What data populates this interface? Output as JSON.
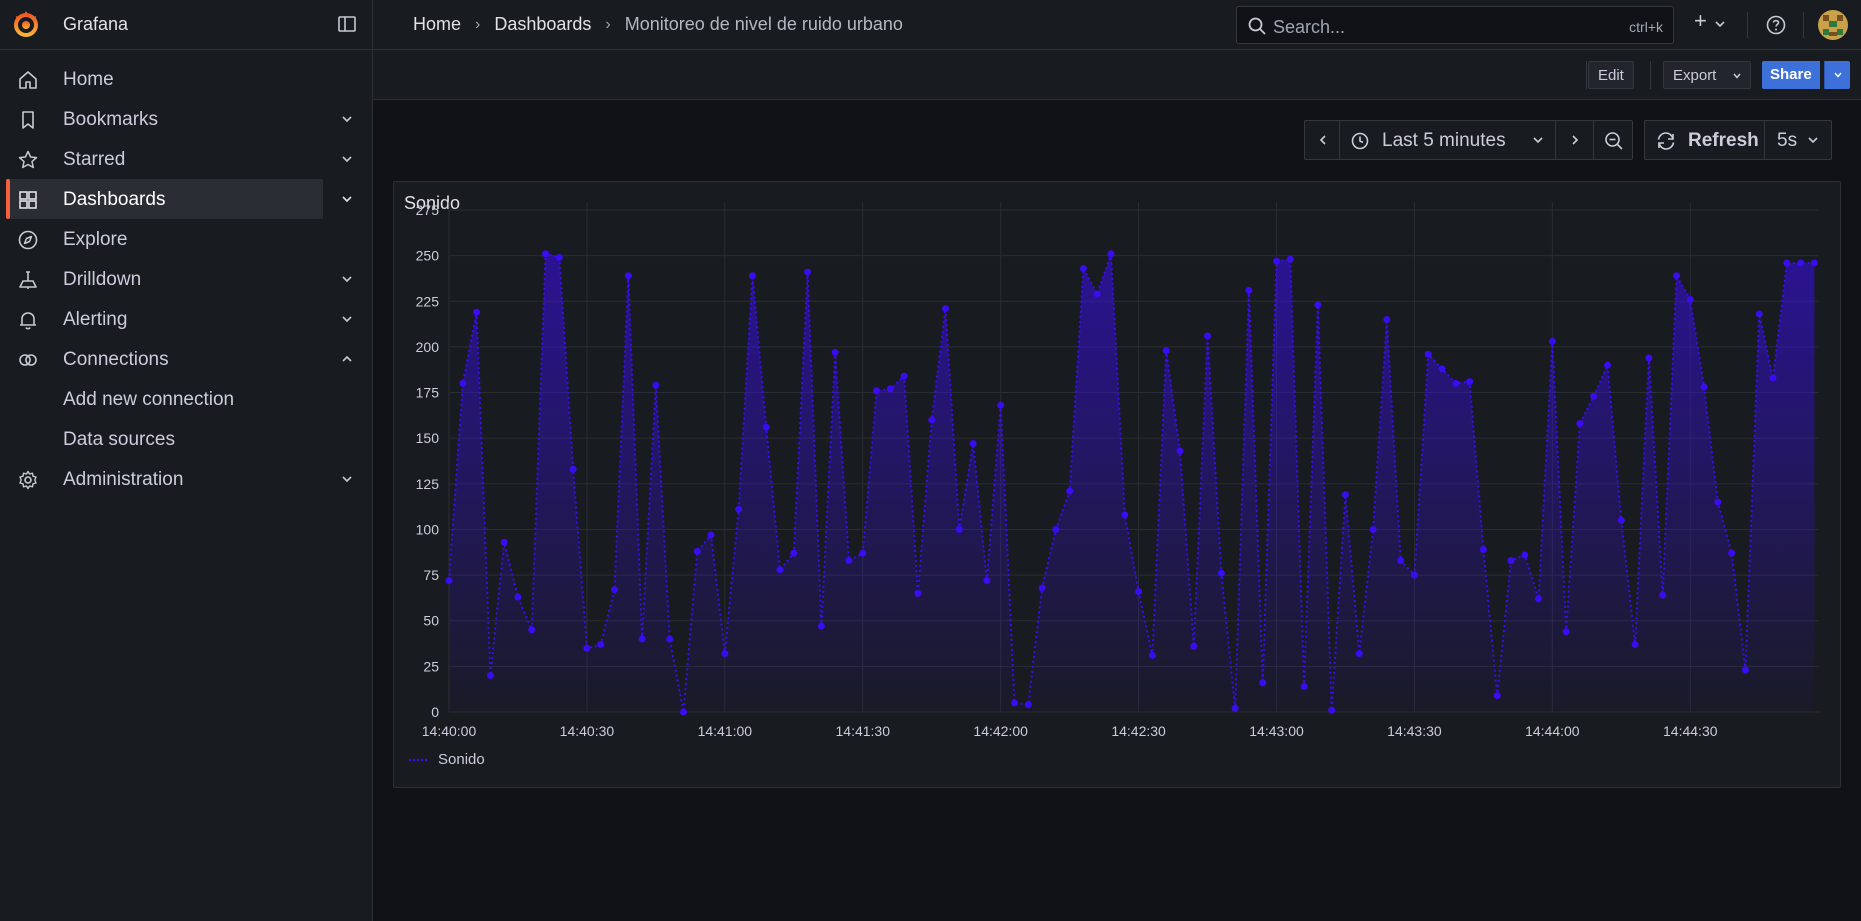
{
  "app": {
    "brand": "Grafana",
    "colors": {
      "accent": "#f55f3e",
      "primary": "#3d71d9",
      "series": "#3a0cf2"
    }
  },
  "breadcrumb": {
    "items": [
      "Home",
      "Dashboards"
    ],
    "current": "Monitoreo de nivel de ruido urbano"
  },
  "search": {
    "placeholder": "Search...",
    "shortcut": "ctrl+k"
  },
  "topbar_icons": [
    "grafana-logo-icon",
    "dock-icon",
    "plus-icon",
    "help-icon",
    "avatar"
  ],
  "sidebar": {
    "items": [
      {
        "label": "Home",
        "icon": "home-icon",
        "has_chevron": false
      },
      {
        "label": "Bookmarks",
        "icon": "bookmark-icon",
        "has_chevron": true
      },
      {
        "label": "Starred",
        "icon": "star-icon",
        "has_chevron": true
      },
      {
        "label": "Dashboards",
        "icon": "dashboards-icon",
        "has_chevron": true,
        "active": true
      },
      {
        "label": "Explore",
        "icon": "compass-icon",
        "has_chevron": false
      },
      {
        "label": "Drilldown",
        "icon": "drilldown-icon",
        "has_chevron": true
      },
      {
        "label": "Alerting",
        "icon": "bell-icon",
        "has_chevron": true
      },
      {
        "label": "Connections",
        "icon": "connections-icon",
        "has_chevron": true,
        "expanded": true
      },
      {
        "label": "Administration",
        "icon": "gear-icon",
        "has_chevron": true
      }
    ],
    "connections_children": [
      "Add new connection",
      "Data sources"
    ]
  },
  "toolbar": {
    "edit_label": "Edit",
    "export_label": "Export",
    "share_label": "Share"
  },
  "time_controls": {
    "range_label": "Last 5 minutes",
    "refresh_label": "Refresh",
    "interval": "5s"
  },
  "panel": {
    "title": "Sonido"
  },
  "chart_data": {
    "type": "line",
    "title": "Sonido",
    "x_tick_labels": [
      "14:40:00",
      "14:40:30",
      "14:41:00",
      "14:41:30",
      "14:42:00",
      "14:42:30",
      "14:43:00",
      "14:43:30",
      "14:44:00",
      "14:44:30"
    ],
    "x_unit": "seconds from 14:40:00",
    "xlim": [
      0,
      298
    ],
    "ylim": [
      0,
      275
    ],
    "y_ticks": [
      0,
      25,
      50,
      75,
      100,
      125,
      150,
      175,
      200,
      225,
      250,
      275
    ],
    "grid": true,
    "legend": "bottom-left",
    "series": [
      {
        "name": "Sonido",
        "color": "#3a0cf2",
        "style": "dotted-points-with-gradient-fill",
        "x": [
          0,
          3,
          6,
          9,
          12,
          15,
          18,
          21,
          24,
          27,
          30,
          33,
          36,
          39,
          42,
          45,
          48,
          51,
          54,
          57,
          60,
          63,
          66,
          69,
          72,
          75,
          78,
          81,
          84,
          87,
          90,
          93,
          96,
          99,
          102,
          105,
          108,
          111,
          114,
          117,
          120,
          123,
          126,
          129,
          132,
          135,
          138,
          141,
          144,
          147,
          150,
          153,
          156,
          159,
          162,
          165,
          168,
          171,
          174,
          177,
          180,
          183,
          186,
          189,
          192,
          195,
          198,
          201,
          204,
          207,
          210,
          213,
          216,
          219,
          222,
          225,
          228,
          231,
          234,
          237,
          240,
          243,
          246,
          249,
          252,
          255,
          258,
          261,
          264,
          267,
          270,
          273,
          276,
          279,
          282,
          285,
          288,
          291,
          294,
          297
        ],
        "values": [
          72,
          180,
          219,
          20,
          93,
          63,
          45,
          251,
          249,
          133,
          35,
          37,
          67,
          239,
          40,
          179,
          40,
          0,
          88,
          97,
          32,
          111,
          239,
          156,
          78,
          87,
          241,
          47,
          197,
          83,
          87,
          176,
          177,
          184,
          65,
          160,
          221,
          100,
          147,
          72,
          168,
          5,
          4,
          68,
          100,
          121,
          243,
          229,
          251,
          108,
          66,
          31,
          198,
          143,
          36,
          206,
          76,
          2,
          231,
          16,
          247,
          248,
          14,
          223,
          1,
          119,
          32,
          100,
          215,
          83,
          75,
          196,
          188,
          180,
          181,
          89,
          9,
          83,
          86,
          62,
          203,
          44,
          158,
          173,
          190,
          105,
          37,
          194,
          64,
          239,
          226,
          178,
          115,
          87,
          23,
          218,
          183,
          246,
          246,
          246
        ]
      }
    ]
  }
}
